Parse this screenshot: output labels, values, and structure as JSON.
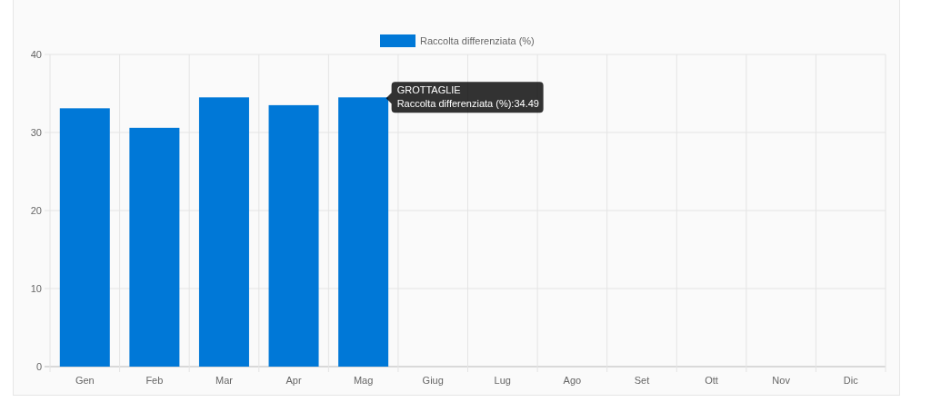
{
  "chart_data": {
    "type": "bar",
    "categories": [
      "Gen",
      "Feb",
      "Mar",
      "Apr",
      "Mag",
      "Giug",
      "Lug",
      "Ago",
      "Set",
      "Ott",
      "Nov",
      "Dic"
    ],
    "series": [
      {
        "name": "Raccolta differenziata (%)",
        "color": "#0078d7",
        "values": [
          33.1,
          30.6,
          34.5,
          33.5,
          34.5,
          null,
          null,
          null,
          null,
          null,
          null,
          null
        ]
      }
    ],
    "ylim": [
      0,
      40
    ],
    "yticks": [
      0,
      10,
      20,
      30,
      40
    ],
    "grid": true
  },
  "tooltip": {
    "title": "GROTTAGLIE",
    "line": "Raccolta differenziata (%):34.49"
  }
}
